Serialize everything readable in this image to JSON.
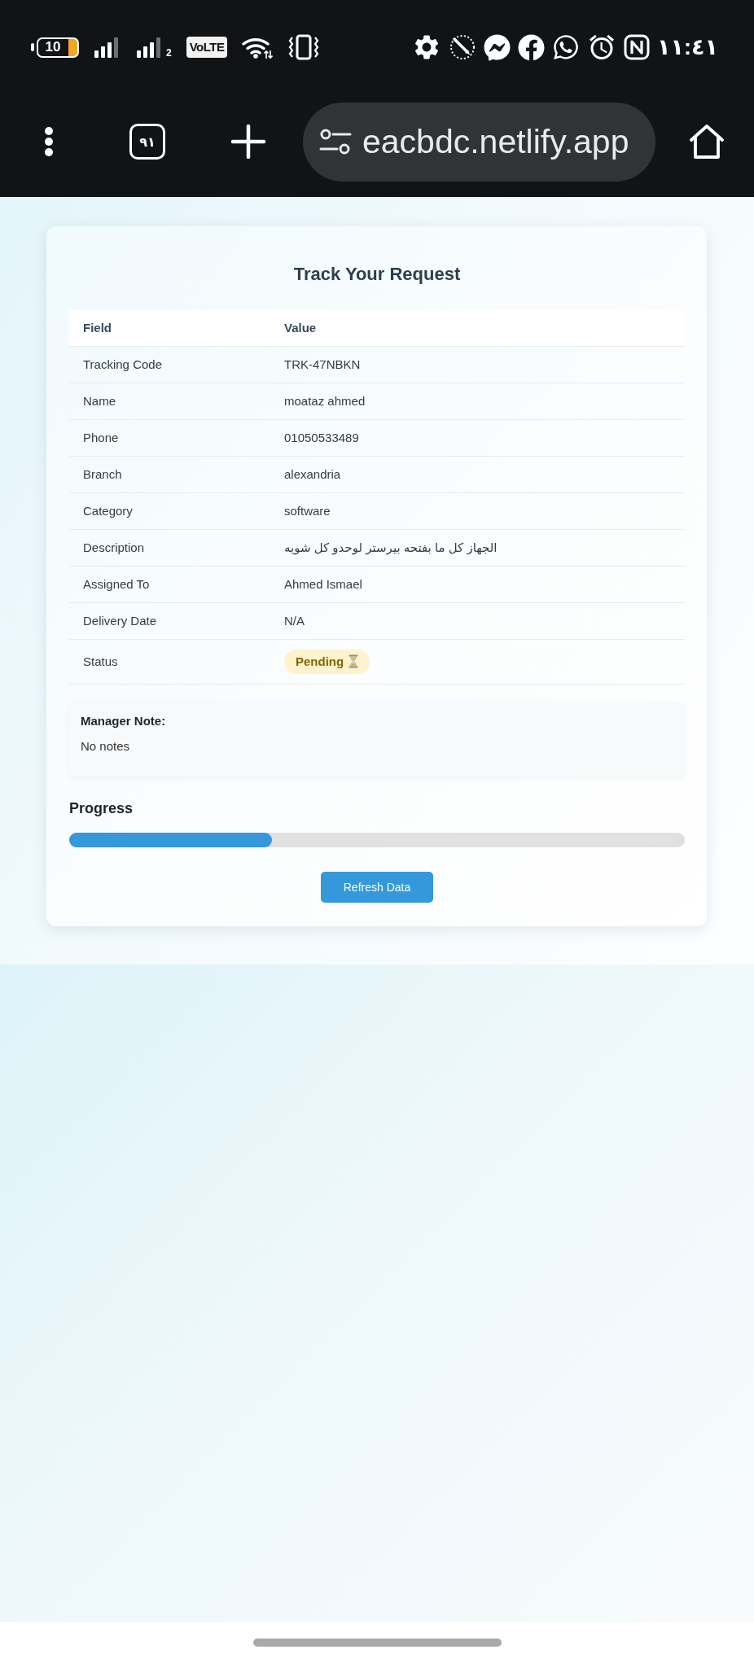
{
  "status_bar": {
    "battery": "10",
    "sim_slot": "2",
    "network_badge": "VoLTE",
    "time": "١١:٤١"
  },
  "browser_bar": {
    "tab_count": "٩١",
    "url": "eacbdc.netlify.app"
  },
  "request_card": {
    "title": "Track Your Request",
    "table": {
      "columns": [
        "Field",
        "Value"
      ],
      "rows": [
        {
          "kind": "text",
          "field": "Tracking Code",
          "value": "TRK-47NBKN"
        },
        {
          "kind": "text",
          "field": "Name",
          "value": "moataz ahmed"
        },
        {
          "kind": "text",
          "field": "Phone",
          "value": "01050533489"
        },
        {
          "kind": "text",
          "field": "Branch",
          "value": "alexandria"
        },
        {
          "kind": "text",
          "field": "Category",
          "value": "software"
        },
        {
          "kind": "text",
          "field": "Description",
          "value": "الجهاز كل ما بفتحه بيرستر لوحدو كل شويه"
        },
        {
          "kind": "text",
          "field": "Assigned To",
          "value": "Ahmed Ismael"
        },
        {
          "kind": "text",
          "field": "Delivery Date",
          "value": "N/A"
        },
        {
          "kind": "badge",
          "field": "Status",
          "value": "Pending"
        }
      ]
    },
    "manager_note": {
      "label": "Manager Note:",
      "text": "No notes"
    },
    "progress": {
      "label": "Progress",
      "level": 0.33
    },
    "button": "Refresh Data"
  }
}
